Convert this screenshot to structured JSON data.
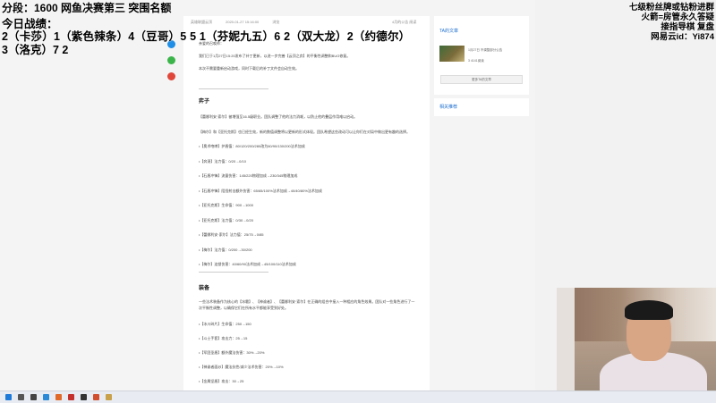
{
  "overlay": {
    "title": "分段：1600 网鱼决赛第三 突围名额",
    "record_label": "今日战绩：",
    "record_line1": "2（卡莎）1（紫色辣条）4（豆哥）5 5 1（芬妮九五）6 2（双大龙）2（约德尔）",
    "record_line2": "3（洛克）7 2",
    "right_lines": [
      "七级粉丝牌或钻粉进群",
      "火箭=房管永久答疑",
      "接指导棋 复盘",
      "网易云id：Yi874"
    ]
  },
  "article": {
    "author": "英雄联盟云顶",
    "date": "2020-01-27 15:16:00",
    "views": "浏览",
    "right_meta": "4月的公告 阅读",
    "intro": "亲爱的召唤师：",
    "intro2": "我们已于1月27日15:20发布了补丁更新，以进一步完善【云顶之弈】的平衡性调整和BUG修复。",
    "intro3": "本次不需要重新启动游戏，同时下载后的补丁文件会自动生效。",
    "section1": "弈子",
    "lines1": [
      "【蕾娜利安·索尔】被增强至16.5级职业。团队调整了他的法力消耗，以防止他的叠层作用难以启动。",
      "【梅尔】和【亚托克斯】也已经生效，新的数值调整将以更新的形式体现。团队希望这些改动可以让你们在对局中做出更有趣的选择。",
      "•【奥术咆哮】护盾值：80/120/200/280改为60/90/130/200法术加成",
      "•【奔溃】法力值：0/20→0/10",
      "•【石盾冲锋】流量伤害：145/220物理加成→230/345物理加成",
      "•【石盾冲锋】阻挡射击额外伤害：65/65/100%法术加成→40/40/80%法术加成",
      "•【亚托克斯】生命值：900→1000",
      "•【亚托克斯】法力值：0/30→0/20",
      "•【蕾娜利安·索尔】法力值：25/75→0/85",
      "•【梅尔】法力值：0/200→30/200",
      "•【梅尔】连锁伤害：40/60/90法术加成→45/100/110法术加成"
    ],
    "section2": "装备",
    "equip_intro": "一些法术装备作为核心的【冰雹】、【神谕者】、【蕾娜利安·索尔】在正确的组合中接入一种相应的角色效果。团队对一些角色进行了一次平衡性调整，以确保它们在所有水平都能享受到好处。",
    "lines2": [
      "•【冰川碎片】生命值：250→150",
      "•【斗士手套】攻击力：25→15",
      "•【军团圣盾】额外魔法伤害：30%→20%",
      "•【神谕者面纱】魔法抗性/减少法术伤害：20%→10%",
      "•【金属坚盾】攻击：30→25"
    ]
  },
  "sidebar": {
    "ta_title": "TA的文章",
    "ta_item_title": "1月27日 不调整部分公告",
    "ta_item_meta": "3 4141阅读",
    "more_button": "更多TA的文章",
    "related_title": "相关推荐"
  },
  "colors": {
    "accent": "#1e6fd0",
    "overlay_text": "#000000"
  }
}
